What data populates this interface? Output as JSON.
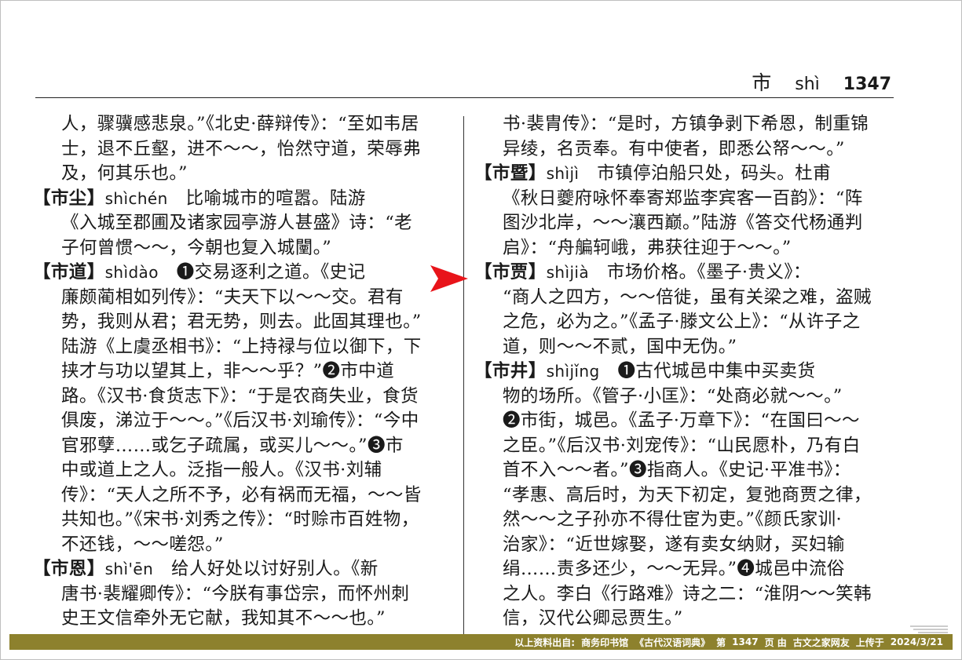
{
  "header": {
    "char": "市",
    "pinyin": "shì",
    "page": "1347"
  },
  "left_column": {
    "lines": [
      {
        "indent": true,
        "text": "人，骤骥感悲泉。”《北史·薛辩传》：“至如韦居"
      },
      {
        "indent": true,
        "text": "士，退不丘壑，进不～～，怡然守道，荣辱弗"
      },
      {
        "indent": true,
        "text": "及，何其乐也。”"
      },
      {
        "hw": "【市尘】",
        "py": "shìchén",
        "text": "　比喻城市的喧嚣。陆游"
      },
      {
        "indent": true,
        "text": "《入城至郡圃及诸家园亭游人甚盛》诗：“老"
      },
      {
        "indent": true,
        "text": "子何曾惯～～，今朝也复入城闉。”"
      },
      {
        "hw": "【市道】",
        "py": "shìdào",
        "text": "　❶交易逐利之道。《史记"
      },
      {
        "indent": true,
        "text": "廉颇蔺相如列传》：“夫天下以～～交。君有"
      },
      {
        "indent": true,
        "text": "势，我则从君；君无势，则去。此固其理也。”"
      },
      {
        "indent": true,
        "text": "陆游《上虞丞相书》：“上持禄与位以御下，下"
      },
      {
        "indent": true,
        "text": "挟才与功以望其上，非～～乎？”❷市中道"
      },
      {
        "indent": true,
        "text": "路。《汉书·食货志下》：“于是农商失业，食货"
      },
      {
        "indent": true,
        "text": "俱废，涕泣于～～。”《后汉书·刘瑜传》：“今中"
      },
      {
        "indent": true,
        "text": "官邪孽……或乞子疏属，或买儿～～。”❸市"
      },
      {
        "indent": true,
        "text": "中或道上之人。泛指一般人。《汉书·刘辅"
      },
      {
        "indent": true,
        "text": "传》：“天人之所不予，必有祸而无福，～～皆"
      },
      {
        "indent": true,
        "text": "共知也。”《宋书·刘秀之传》：“时赊市百姓物，"
      },
      {
        "indent": true,
        "text": "不还钱，～～嗟怨。”"
      },
      {
        "hw": "【市恩】",
        "py": "shì'ēn",
        "text": "　给人好处以讨好别人。《新"
      },
      {
        "indent": true,
        "text": "唐书·裴耀卿传》：“今朕有事岱宗，而怀州刺"
      },
      {
        "indent": true,
        "text": "史王文信牵外无它献，我知其不～～也。”"
      }
    ]
  },
  "right_column": {
    "lines": [
      {
        "indent": true,
        "text": "书·裴胄传》：“是时，方镇争剥下希恩，制重锦"
      },
      {
        "indent": true,
        "text": "异绫，名贡奉。有中使者，即悉公帑～～。”"
      },
      {
        "hw": "【市暨】",
        "py": "shìjì",
        "text": "　市镇停泊船只处，码头。杜甫"
      },
      {
        "indent": true,
        "text": "《秋日夔府咏怀奉寄郑监李宾客一百韵》：“阵"
      },
      {
        "indent": true,
        "text": "图沙北岸，～～瀼西巅。”陆游《答交代杨通判"
      },
      {
        "indent": true,
        "text": "启》：“舟艑轲峨，弗获往迎于～～。”"
      },
      {
        "hw": "【市贾】",
        "py": "shìjià",
        "text": "　市场价格。《墨子·贵义》："
      },
      {
        "indent": true,
        "text": "“商人之四方，～～倍徙，虽有关梁之难，盗贼"
      },
      {
        "indent": true,
        "text": "之危，必为之。”《孟子·滕文公上》：“从许子之"
      },
      {
        "indent": true,
        "text": "道，则～～不贰，国中无伪。”"
      },
      {
        "hw": "【市井】",
        "py": "shìjǐng",
        "text": "　❶古代城邑中集中买卖货"
      },
      {
        "indent": true,
        "text": "物的场所。《管子·小匡》：“处商必就～～。”"
      },
      {
        "indent": true,
        "text": "❷市街，城邑。《孟子·万章下》：“在国曰～～"
      },
      {
        "indent": true,
        "text": "之臣。”《后汉书·刘宠传》：“山民愿朴，乃有白"
      },
      {
        "indent": true,
        "text": "首不入～～者。”❸指商人。《史记·平准书》："
      },
      {
        "indent": true,
        "text": "“孝惠、高后时，为天下初定，复弛商贾之律，"
      },
      {
        "indent": true,
        "text": "然～～之子孙亦不得仕宦为吏。”《颜氏家训·"
      },
      {
        "indent": true,
        "text": "治家》：“近世嫁娶，遂有卖女纳财，买妇输"
      },
      {
        "indent": true,
        "text": "绢……责多还少，～～无异。”❹城邑中流俗"
      },
      {
        "indent": true,
        "text": "之人。李白《行路难》诗之二：“淮阴～～笑韩"
      },
      {
        "indent": true,
        "text": "信，汉代公卿忌贾生。”"
      }
    ]
  },
  "footer": {
    "source_label": "以上资料出自:",
    "publisher": "商务印书馆",
    "book": "《古代汉语词典》",
    "page_label": "第",
    "page": "1347",
    "page_suffix": "页 由",
    "uploader": "古文之家网友",
    "upload_label": "上传于",
    "date": "2024/3/21"
  },
  "colors": {
    "footer_bg": "#8d812d",
    "arrow": "#e8141a"
  },
  "icons": {
    "pointer": "arrow-right-icon"
  }
}
